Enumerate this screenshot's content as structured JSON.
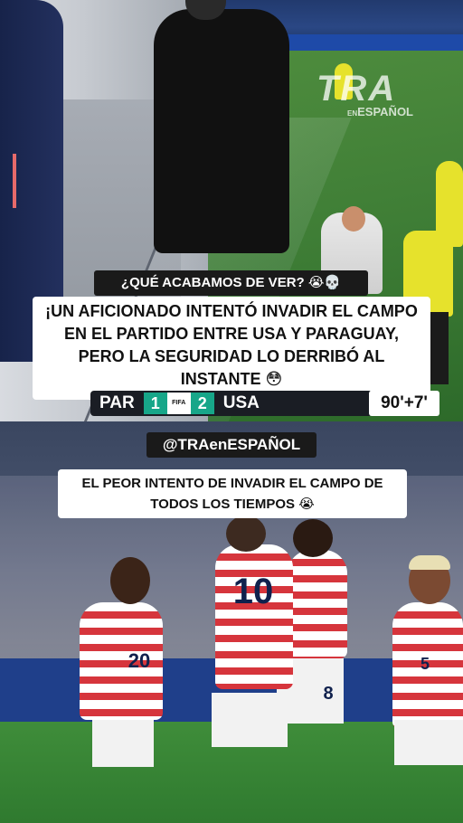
{
  "top_clip": {
    "logo": {
      "main": "TRA",
      "sub": "ESPAÑOL",
      "sub_prefix": "EN"
    },
    "tag": "¿QUÉ ACABAMOS DE VER? 😭💀",
    "headline": "¡UN AFICIONADO INTENTÓ INVADIR EL CAMPO EN EL PARTIDO ENTRE USA Y PARAGUAY, PERO LA SEGURIDAD LO DERRIBÓ AL INSTANTE 😳",
    "scoreboard": {
      "home_team": "PAR",
      "home_score": "1",
      "competition_logo": "FIFA",
      "away_score": "2",
      "away_team": "USA",
      "time": "90'+7'"
    }
  },
  "handle": "@TRAenESPAÑOL",
  "bottom_clip": {
    "caption": "EL PEOR INTENTO DE INVADIR EL CAMPO DE TODOS LOS TIEMPOS 😭",
    "player_numbers": [
      "20",
      "10",
      "8",
      "5"
    ]
  },
  "colors": {
    "pitch": "#3f7e36",
    "stands_blue": "#1f3f8a",
    "caption_bg": "#ffffff",
    "tag_bg": "#1a1a1a",
    "score_teal": "#17a689",
    "kit_red": "#d6353c"
  }
}
